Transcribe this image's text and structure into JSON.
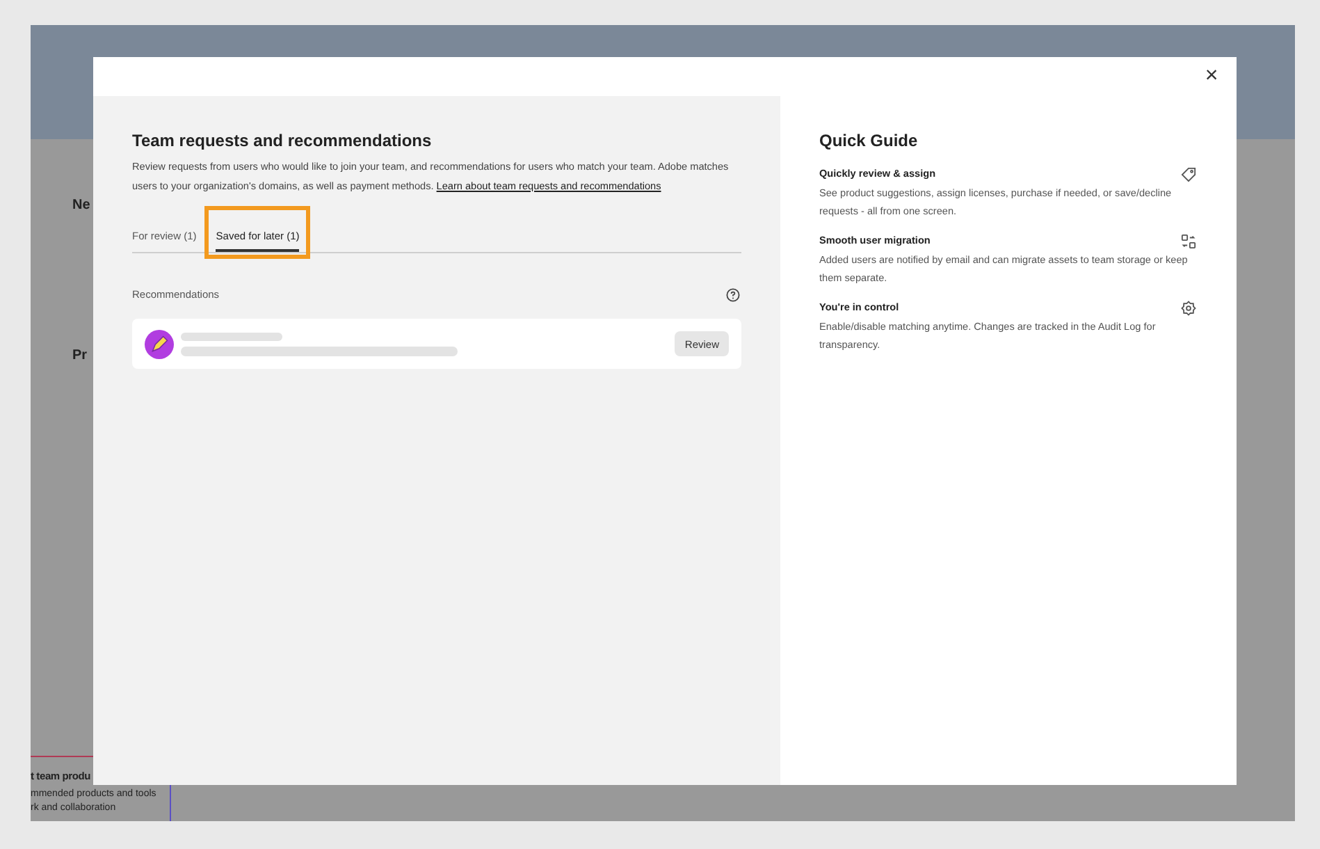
{
  "background": {
    "heading_fragments": [
      "Ne",
      "Pr"
    ],
    "card_title_fragment": "t team produ",
    "card_text_fragment": [
      "mmended products and tools",
      "rk and collaboration"
    ]
  },
  "dialog": {
    "close_label": "×",
    "main": {
      "title": "Team requests and recommendations",
      "description": "Review requests from users who would like to join your team, and recommendations for users who match your team. Adobe matches users to your organization's domains, as well as payment methods.",
      "link": "Learn about team requests and recommendations",
      "tabs": [
        {
          "label": "For review (1)",
          "selected": false,
          "highlighted": false
        },
        {
          "label": "Saved for later (1)",
          "selected": true,
          "highlighted": true
        }
      ],
      "section_label": "Recommendations",
      "recommendations": [
        {
          "button": "Review"
        }
      ]
    },
    "guide": {
      "title": "Quick Guide",
      "items": [
        {
          "title": "Quickly review & assign",
          "text": "See product suggestions, assign licenses, purchase if needed, or save/decline requests - all from one screen."
        },
        {
          "title": "Smooth user migration",
          "text": "Added users are notified by email and can migrate assets to team storage or keep them separate."
        },
        {
          "title": "You're in control",
          "text": "Enable/disable matching anytime. Changes are tracked in the Audit Log for transparency."
        }
      ]
    }
  }
}
